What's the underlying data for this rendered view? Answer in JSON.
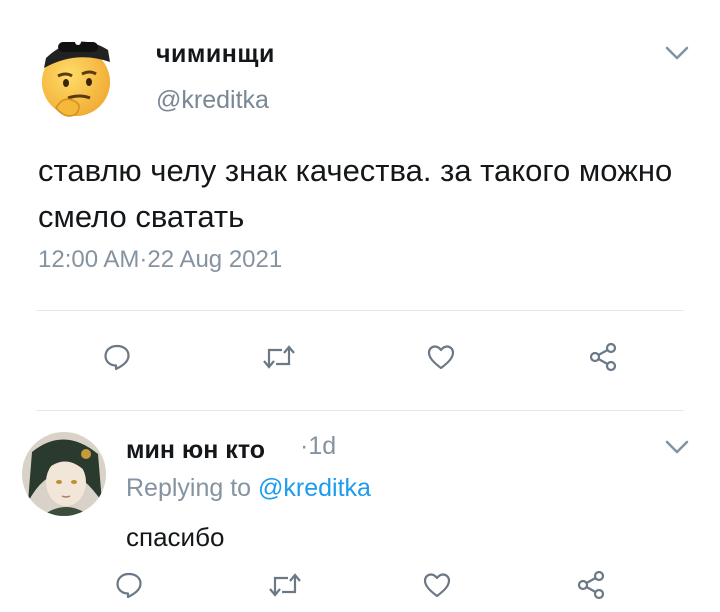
{
  "tweet": {
    "display_name": "чиминщи",
    "handle": "@kreditka",
    "text": "ставлю челу знак качества. за такого можно смело сватать",
    "time": "12:00 AM",
    "date_sep": "·",
    "date": "22 Aug 2021"
  },
  "actions": {
    "reply_icon": "reply-icon",
    "retweet_icon": "retweet-icon",
    "like_icon": "heart-icon",
    "share_icon": "share-icon"
  },
  "reply": {
    "display_name": "мин юн кто",
    "time_sep": "·",
    "time": "1d",
    "replying_prefix": "Replying to",
    "replying_handle": "@kreditka",
    "text": "спасибо"
  },
  "colors": {
    "text": "#14171a",
    "secondary": "#8593a0",
    "link": "#1d9bf0",
    "icon": "#6b7885"
  }
}
